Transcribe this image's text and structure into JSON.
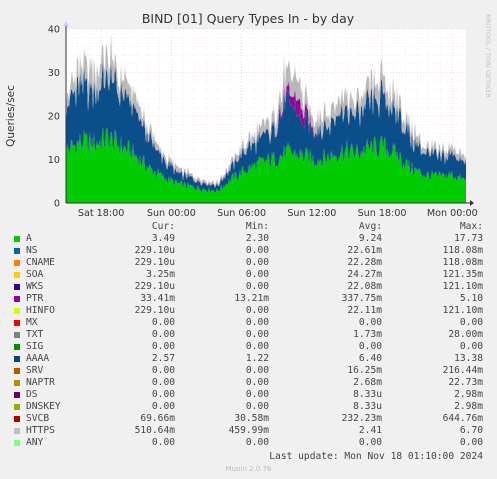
{
  "chart_data": {
    "type": "area",
    "title": "BIND [01] Query Types In - by day",
    "ylabel": "Queries/sec",
    "side_label": "RRDTOOL / TOBI OETIKER",
    "ylim": [
      0,
      40
    ],
    "yticks": [
      "0",
      "10",
      "20",
      "30",
      "40"
    ],
    "xticks": [
      "Sat 18:00",
      "Sun 00:00",
      "Sun 06:00",
      "Sun 12:00",
      "Sun 18:00",
      "Mon 00:00"
    ],
    "x_hours": [
      0,
      2,
      4,
      6,
      8,
      10,
      12,
      14,
      16,
      18,
      20,
      22,
      24,
      26,
      28,
      30,
      32,
      34
    ],
    "series": [
      {
        "name": "A",
        "color": "#00cc00",
        "values": [
          12,
          14,
          13.5,
          15,
          13,
          11,
          8,
          6,
          4.5,
          3.8,
          3.2,
          2.8,
          5.5,
          7.5,
          9,
          10,
          11.5,
          11,
          10,
          10.5,
          12,
          11.5,
          12.5,
          13,
          11,
          8,
          6.5,
          6,
          6.5,
          5
        ]
      },
      {
        "name": "AAAA",
        "color": "#0b4f8a",
        "values": [
          10,
          13,
          12,
          14,
          12,
          10,
          7,
          4,
          2.5,
          2,
          1.5,
          1.2,
          2.8,
          4.5,
          5.5,
          6.5,
          12,
          8,
          7,
          7.5,
          9,
          8.5,
          10,
          11,
          10,
          7,
          5,
          4.5,
          5,
          4
        ]
      },
      {
        "name": "PTR",
        "color": "#990099",
        "values": [
          0.1,
          0.1,
          0.1,
          0.1,
          0.1,
          0.1,
          0.1,
          0.1,
          0.1,
          0.1,
          0.1,
          0.1,
          0.1,
          0.1,
          0.1,
          0.1,
          1.5,
          3.5,
          0.3,
          0.1,
          0.1,
          0.1,
          0.1,
          0.1,
          0.1,
          0.1,
          0.1,
          0.1,
          0.1,
          0.1
        ]
      },
      {
        "name": "HTTPS",
        "color": "#b8b8b8",
        "values": [
          2.5,
          4,
          4.5,
          5,
          3.5,
          3,
          2,
          1.2,
          1,
          0.8,
          0.6,
          0.5,
          1,
          1.5,
          2,
          2.5,
          5,
          3.5,
          2.5,
          3,
          3.5,
          3,
          3.5,
          4,
          3,
          2.5,
          1.5,
          1.2,
          1.5,
          1.2
        ]
      }
    ],
    "legend_columns": [
      "Cur:",
      "Min:",
      "Avg:",
      "Max:"
    ],
    "legend": [
      {
        "name": "A",
        "color": "#00cc00",
        "cur": "3.49",
        "min": "2.30",
        "avg": "9.24",
        "max": "17.73"
      },
      {
        "name": "NS",
        "color": "#0066b3",
        "cur": "229.10u",
        "min": "0.00",
        "avg": "22.61m",
        "max": "118.08m"
      },
      {
        "name": "CNAME",
        "color": "#ff8000",
        "cur": "229.10u",
        "min": "0.00",
        "avg": "22.28m",
        "max": "118.08m"
      },
      {
        "name": "SOA",
        "color": "#ffcc00",
        "cur": "3.25m",
        "min": "0.00",
        "avg": "24.27m",
        "max": "121.35m"
      },
      {
        "name": "WKS",
        "color": "#330099",
        "cur": "229.10u",
        "min": "0.00",
        "avg": "22.08m",
        "max": "121.10m"
      },
      {
        "name": "PTR",
        "color": "#990099",
        "cur": "33.41m",
        "min": "13.21m",
        "avg": "337.75m",
        "max": "5.10"
      },
      {
        "name": "HINFO",
        "color": "#ccff00",
        "cur": "229.10u",
        "min": "0.00",
        "avg": "22.11m",
        "max": "121.10m"
      },
      {
        "name": "MX",
        "color": "#ff0000",
        "cur": "0.00",
        "min": "0.00",
        "avg": "0.00",
        "max": "0.00"
      },
      {
        "name": "TXT",
        "color": "#808080",
        "cur": "0.00",
        "min": "0.00",
        "avg": "1.73m",
        "max": "28.00m"
      },
      {
        "name": "SIG",
        "color": "#008f00",
        "cur": "0.00",
        "min": "0.00",
        "avg": "0.00",
        "max": "0.00"
      },
      {
        "name": "AAAA",
        "color": "#00487d",
        "cur": "2.57",
        "min": "1.22",
        "avg": "6.40",
        "max": "13.38"
      },
      {
        "name": "SRV",
        "color": "#b35a00",
        "cur": "0.00",
        "min": "0.00",
        "avg": "16.25m",
        "max": "216.44m"
      },
      {
        "name": "NAPTR",
        "color": "#b38f00",
        "cur": "0.00",
        "min": "0.00",
        "avg": "2.68m",
        "max": "22.73m"
      },
      {
        "name": "DS",
        "color": "#6b006b",
        "cur": "0.00",
        "min": "0.00",
        "avg": "8.33u",
        "max": "2.98m"
      },
      {
        "name": "DNSKEY",
        "color": "#8fb300",
        "cur": "0.00",
        "min": "0.00",
        "avg": "8.33u",
        "max": "2.98m"
      },
      {
        "name": "SVCB",
        "color": "#b30000",
        "cur": "69.66m",
        "min": "30.58m",
        "avg": "232.23m",
        "max": "644.76m"
      },
      {
        "name": "HTTPS",
        "color": "#bebebe",
        "cur": "510.64m",
        "min": "459.99m",
        "avg": "2.41",
        "max": "6.70"
      },
      {
        "name": "ANY",
        "color": "#80ff80",
        "cur": "0.00",
        "min": "0.00",
        "avg": "0.00",
        "max": "0.00"
      }
    ],
    "grid": true
  },
  "footer": {
    "last_update": "Last update: Mon Nov 18 01:10:00 2024",
    "version": "Munin 2.0.76"
  }
}
